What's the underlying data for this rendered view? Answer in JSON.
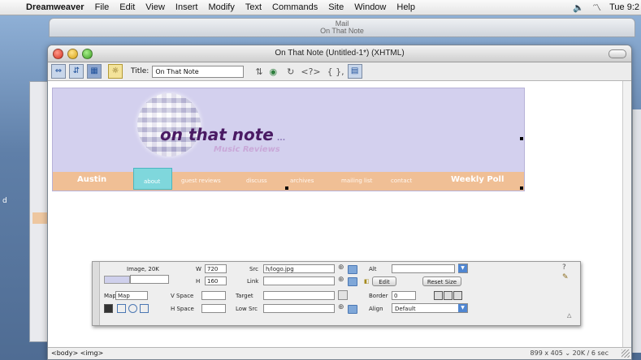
{
  "menubar": {
    "app_name": "Dreamweaver",
    "items": [
      "File",
      "Edit",
      "View",
      "Insert",
      "Modify",
      "Text",
      "Commands",
      "Site",
      "Window",
      "Help"
    ],
    "clock": "Tue 9:2"
  },
  "background": {
    "mail_title": "Mail",
    "mail_subtitle": "On That Note"
  },
  "window": {
    "title": "On That Note (Untitled-1*) (XHTML)"
  },
  "toolbar": {
    "title_label": "Title:",
    "title_value": "On That Note",
    "code_icon": "<?>",
    "brace_icon": "{ },"
  },
  "banner": {
    "logo_text": "on that note",
    "logo_dots": "...",
    "tagline": "Music Reviews",
    "nav": {
      "austin": "Austin",
      "about": "about",
      "guest_reviews": "guest reviews",
      "discuss": "discuss",
      "archives": "archives",
      "mailing_list": "mailing list",
      "contact": "contact",
      "weekly_poll": "Weekly Poll"
    }
  },
  "inspector": {
    "type_label": "Image, 20K",
    "w_label": "W",
    "w_value": "720",
    "h_label": "H",
    "h_value": "160",
    "src_label": "Src",
    "src_value": "h/logo.jpg",
    "link_label": "Link",
    "link_value": "",
    "alt_label": "Alt",
    "alt_value": "",
    "edit_label": "Edit",
    "reset_label": "Reset Size",
    "map_label": "Map",
    "map_value": "Map",
    "vspace_label": "V Space",
    "hspace_label": "H Space",
    "target_label": "Target",
    "lowsrc_label": "Low Src",
    "border_label": "Border",
    "border_value": "0",
    "align_label": "Align",
    "align_value": "Default"
  },
  "status": {
    "tag_selector": "<body> <img>",
    "info": "899 x 405 ⌄ 20K / 6 sec"
  }
}
